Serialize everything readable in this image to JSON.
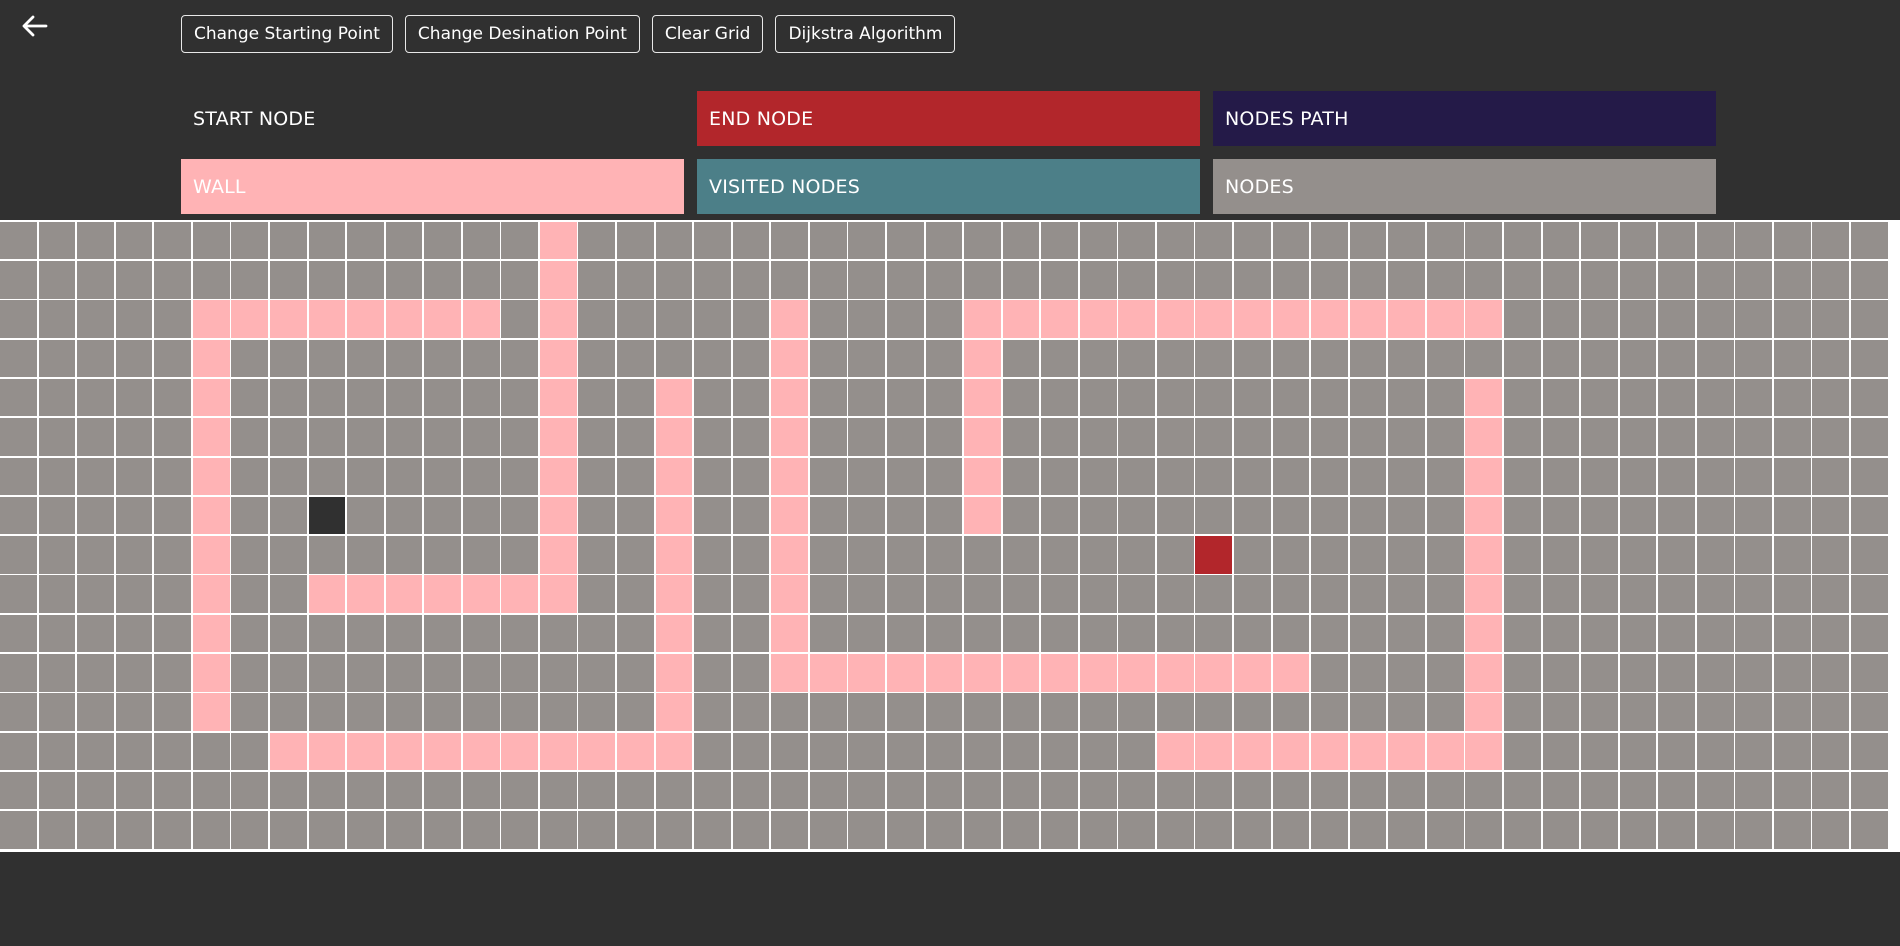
{
  "toolbar": {
    "buttons": [
      {
        "label": "Change Starting Point"
      },
      {
        "label": "Change Desination Point"
      },
      {
        "label": "Clear Grid"
      },
      {
        "label": "Dijkstra Algorithm"
      }
    ]
  },
  "legend": {
    "items": [
      {
        "label": "START NODE",
        "color": "#303030"
      },
      {
        "label": "END NODE",
        "color": "#b2262b"
      },
      {
        "label": "NODES PATH",
        "color": "#241a48"
      },
      {
        "label": "WALL",
        "color": "#ffb3b5"
      },
      {
        "label": "VISITED NODES",
        "color": "#4c7f88"
      },
      {
        "label": "NODES",
        "color": "#948f8c"
      }
    ]
  },
  "grid": {
    "rows": 16,
    "cols": 49,
    "start": [
      7,
      8
    ],
    "end": [
      8,
      31
    ],
    "walls": [
      {
        "r": 0,
        "from": 14,
        "to": 14
      },
      {
        "r": 1,
        "from": 14,
        "to": 14
      },
      {
        "r": 2,
        "from": 5,
        "to": 12
      },
      {
        "r": 2,
        "from": 14,
        "to": 14
      },
      {
        "r": 2,
        "from": 20,
        "to": 20
      },
      {
        "r": 2,
        "from": 25,
        "to": 38
      },
      {
        "r": 3,
        "from": 5,
        "to": 5
      },
      {
        "r": 3,
        "from": 14,
        "to": 14
      },
      {
        "r": 3,
        "from": 20,
        "to": 20
      },
      {
        "r": 3,
        "from": 25,
        "to": 25
      },
      {
        "r": 4,
        "from": 5,
        "to": 5
      },
      {
        "r": 4,
        "from": 14,
        "to": 14
      },
      {
        "r": 4,
        "from": 17,
        "to": 17
      },
      {
        "r": 4,
        "from": 20,
        "to": 20
      },
      {
        "r": 4,
        "from": 25,
        "to": 25
      },
      {
        "r": 4,
        "from": 38,
        "to": 38
      },
      {
        "r": 5,
        "from": 5,
        "to": 5
      },
      {
        "r": 5,
        "from": 14,
        "to": 14
      },
      {
        "r": 5,
        "from": 17,
        "to": 17
      },
      {
        "r": 5,
        "from": 20,
        "to": 20
      },
      {
        "r": 5,
        "from": 25,
        "to": 25
      },
      {
        "r": 5,
        "from": 38,
        "to": 38
      },
      {
        "r": 6,
        "from": 5,
        "to": 5
      },
      {
        "r": 6,
        "from": 14,
        "to": 14
      },
      {
        "r": 6,
        "from": 17,
        "to": 17
      },
      {
        "r": 6,
        "from": 20,
        "to": 20
      },
      {
        "r": 6,
        "from": 25,
        "to": 25
      },
      {
        "r": 6,
        "from": 38,
        "to": 38
      },
      {
        "r": 7,
        "from": 5,
        "to": 5
      },
      {
        "r": 7,
        "from": 14,
        "to": 14
      },
      {
        "r": 7,
        "from": 17,
        "to": 17
      },
      {
        "r": 7,
        "from": 20,
        "to": 20
      },
      {
        "r": 7,
        "from": 25,
        "to": 25
      },
      {
        "r": 7,
        "from": 38,
        "to": 38
      },
      {
        "r": 8,
        "from": 5,
        "to": 5
      },
      {
        "r": 8,
        "from": 14,
        "to": 14
      },
      {
        "r": 8,
        "from": 17,
        "to": 17
      },
      {
        "r": 8,
        "from": 20,
        "to": 20
      },
      {
        "r": 8,
        "from": 38,
        "to": 38
      },
      {
        "r": 9,
        "from": 5,
        "to": 5
      },
      {
        "r": 9,
        "from": 8,
        "to": 14
      },
      {
        "r": 9,
        "from": 17,
        "to": 17
      },
      {
        "r": 9,
        "from": 20,
        "to": 20
      },
      {
        "r": 9,
        "from": 38,
        "to": 38
      },
      {
        "r": 10,
        "from": 5,
        "to": 5
      },
      {
        "r": 10,
        "from": 17,
        "to": 17
      },
      {
        "r": 10,
        "from": 20,
        "to": 20
      },
      {
        "r": 10,
        "from": 38,
        "to": 38
      },
      {
        "r": 11,
        "from": 5,
        "to": 5
      },
      {
        "r": 11,
        "from": 17,
        "to": 17
      },
      {
        "r": 11,
        "from": 20,
        "to": 33
      },
      {
        "r": 11,
        "from": 38,
        "to": 38
      },
      {
        "r": 12,
        "from": 5,
        "to": 5
      },
      {
        "r": 12,
        "from": 17,
        "to": 17
      },
      {
        "r": 12,
        "from": 38,
        "to": 38
      },
      {
        "r": 13,
        "from": 7,
        "to": 17
      },
      {
        "r": 13,
        "from": 30,
        "to": 38
      }
    ]
  }
}
